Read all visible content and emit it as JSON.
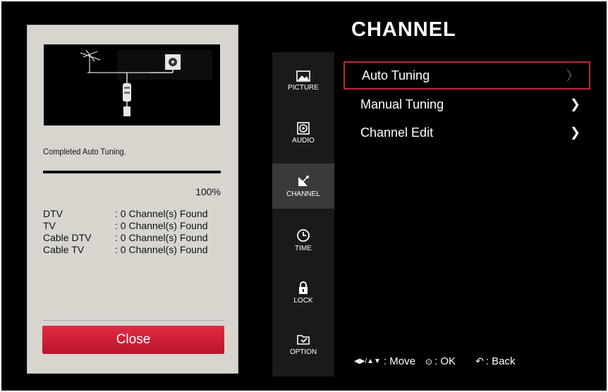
{
  "dialog": {
    "status_text": "Completed Auto Tuning.",
    "progress_value": 1.0,
    "progress_label": "100%",
    "results": [
      {
        "label": "DTV",
        "value": ": 0 Channel(s) Found"
      },
      {
        "label": "TV",
        "value": ": 0 Channel(s) Found"
      },
      {
        "label": "Cable DTV",
        "value": ": 0 Channel(s) Found"
      },
      {
        "label": "Cable TV",
        "value": ": 0 Channel(s) Found"
      }
    ],
    "close_label": "Close"
  },
  "sidenav": {
    "items": [
      {
        "label": "PICTURE",
        "icon": "picture-icon"
      },
      {
        "label": "AUDIO",
        "icon": "speaker-icon"
      },
      {
        "label": "CHANNEL",
        "icon": "satellite-icon",
        "active": true
      },
      {
        "label": "TIME",
        "icon": "clock-icon"
      },
      {
        "label": "LOCK",
        "icon": "lock-icon"
      },
      {
        "label": "OPTION",
        "icon": "option-icon"
      }
    ]
  },
  "menu": {
    "title": "CHANNEL",
    "items": [
      {
        "label": "Auto Tuning",
        "focused": true
      },
      {
        "label": "Manual Tuning"
      },
      {
        "label": "Channel Edit"
      }
    ]
  },
  "help": {
    "move_label": ": Move",
    "ok_label": ": OK",
    "back_label": ": Back"
  },
  "colors": {
    "accent": "#c0243b",
    "close_button": "#d21f3a"
  }
}
